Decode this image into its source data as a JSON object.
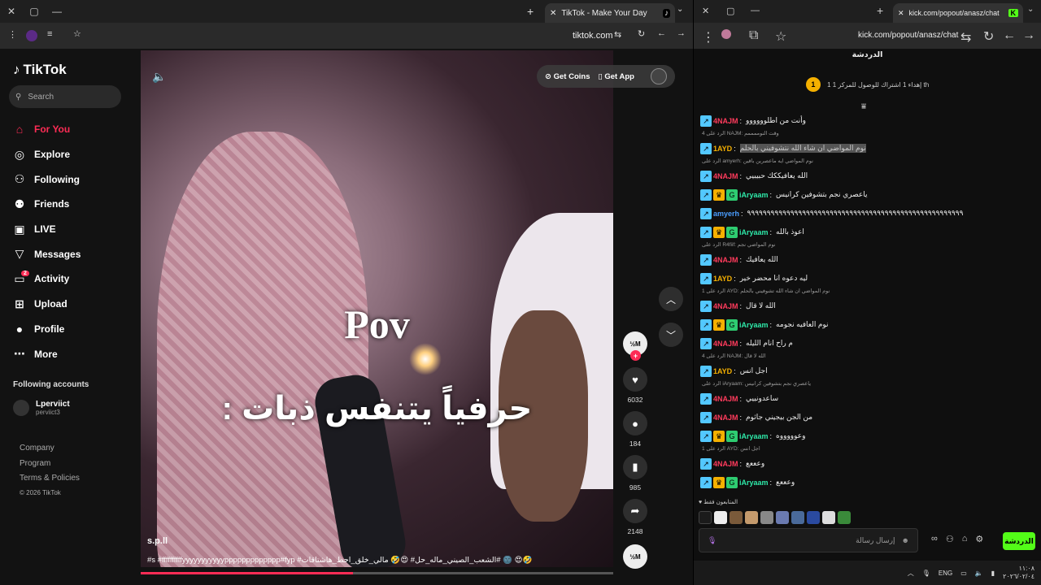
{
  "left_window": {
    "tab_title": "TikTok - Make Your Day",
    "address": "tiktok.com"
  },
  "tiktok": {
    "logo_text": "TikTok",
    "search_placeholder": "Search",
    "nav": [
      {
        "label": "For You",
        "icon": "home-icon",
        "active": true
      },
      {
        "label": "Explore",
        "icon": "compass-icon"
      },
      {
        "label": "Following",
        "icon": "following-icon"
      },
      {
        "label": "Friends",
        "icon": "friends-icon"
      },
      {
        "label": "LIVE",
        "icon": "live-icon"
      },
      {
        "label": "Messages",
        "icon": "messages-icon"
      },
      {
        "label": "Activity",
        "icon": "activity-icon",
        "badge": "2"
      },
      {
        "label": "Upload",
        "icon": "upload-icon"
      },
      {
        "label": "Profile",
        "icon": "profile-icon"
      },
      {
        "label": "More",
        "icon": "more-icon"
      }
    ],
    "following_accounts_title": "Following accounts",
    "following_account": {
      "name": "Lperviict",
      "handle": "perviict3"
    },
    "footer": {
      "company": "Company",
      "program": "Program",
      "terms": "Terms & Policies",
      "copyright": "© 2026 TikTok"
    },
    "top_actions": {
      "get_coins": "Get Coins",
      "get_app": "Get App"
    },
    "video": {
      "overlay_title": "Pov",
      "overlay_caption": "حرفياً يتنفس ذبات :",
      "author": "s.p.ll",
      "description": "#s #ffffffffffyyyyyyyyyyyppppppppppppp#fyp #الشعب_الصيني_ماله_حل# 😍🤣 مالي_خلق_احط_هاشتاقات# 🌚 😍🤣",
      "progress": 0.45
    },
    "actions": {
      "avatar_label": "½M",
      "likes": "6032",
      "comments": "184",
      "saves": "985",
      "shares": "2148",
      "bottom_avatar_label": "½M"
    }
  },
  "right_window": {
    "tab_title": "kick.com/popout/anasz/chat",
    "address": "kick.com/popout/anasz/chat",
    "chat_title": "الدردشة",
    "pinned_text": "1 إهداء 1 اشتراك للوصول للمركز 1 th",
    "pinned_rank": "1",
    "messages": [
      {
        "reply": "",
        "user": "4NAJM",
        "color": "#ff3b5c",
        "badges": [
          "bot"
        ],
        "text": "وأنت من اطلوووووو",
        "highlight": false
      },
      {
        "reply": "الرد على 4 NAJM: وقت النوممممم",
        "user": "1AYD",
        "color": "#f5b000",
        "badges": [
          "bot"
        ],
        "text": "نوم المواضي ان شاء الله نتشوفيني بالحلم",
        "highlight": true
      },
      {
        "reply": "الرد على amyerh: نوم المواضي ايه ماعصرين باقين",
        "user": "4NAJM",
        "color": "#ff3b5c",
        "badges": [
          "bot"
        ],
        "text": "الله يعافيككك حبيبيي",
        "highlight": false
      },
      {
        "reply": "",
        "user": "iAryaam",
        "color": "#2ee8a8",
        "badges": [
          "bot",
          "crown",
          "gift"
        ],
        "text": "ياعصري نجم بتشوفين كرانيس",
        "highlight": false
      },
      {
        "reply": "",
        "user": "amyerh",
        "color": "#4a9eff",
        "badges": [
          "bot"
        ],
        "text": "٩٩٩٩٩٩٩٩٩٩٩٩٩٩٩٩٩٩٩٩٩٩٩٩٩٩٩٩٩٩٩٩٩٩٩٩٩٩٩٩٩٩٩٩٩٩٩٩٩٩٩٩٩٩٩",
        "highlight": false
      },
      {
        "reply": "",
        "user": "iAryaam",
        "color": "#2ee8a8",
        "badges": [
          "bot",
          "crown",
          "gift"
        ],
        "text": "اعوذ بالله",
        "highlight": false
      },
      {
        "reply": "الرد على R4fiif: نوم المواضي نجم",
        "user": "4NAJM",
        "color": "#ff3b5c",
        "badges": [
          "bot"
        ],
        "text": "الله يعافيك",
        "highlight": false
      },
      {
        "reply": "",
        "user": "1AYD",
        "color": "#f5b000",
        "badges": [
          "bot"
        ],
        "text": "ليه دعوه انا محضر خير",
        "highlight": false
      },
      {
        "reply": "الرد على 1 AYD: نوم المواضي ان شاء الله تشوفيني بالحلم",
        "user": "4NAJM",
        "color": "#ff3b5c",
        "badges": [
          "bot"
        ],
        "text": "الله لا قال",
        "highlight": false
      },
      {
        "reply": "",
        "user": "iAryaam",
        "color": "#2ee8a8",
        "badges": [
          "bot",
          "crown",
          "gift"
        ],
        "text": "نوم العافيه نجومه",
        "highlight": false
      },
      {
        "reply": "",
        "user": "4NAJM",
        "color": "#ff3b5c",
        "badges": [
          "bot"
        ],
        "text": "م راح انام الليله",
        "highlight": false
      },
      {
        "reply": "الرد على 4 NAJM: الله لا قال",
        "user": "1AYD",
        "color": "#f5b000",
        "badges": [
          "bot"
        ],
        "text": "اجل انس",
        "highlight": false
      },
      {
        "reply": "الرد على iAryaam: ياعصري نجم بتشوفين كرانيس",
        "user": "4NAJM",
        "color": "#ff3b5c",
        "badges": [
          "bot"
        ],
        "text": "ساعدونييي",
        "highlight": false
      },
      {
        "reply": "",
        "user": "4NAJM",
        "color": "#ff3b5c",
        "badges": [
          "bot"
        ],
        "text": "من الجن بيجيني جاثوم",
        "highlight": false
      },
      {
        "reply": "",
        "user": "iAryaam",
        "color": "#2ee8a8",
        "badges": [
          "bot",
          "crown",
          "gift"
        ],
        "text": "وعوووووه",
        "highlight": false
      },
      {
        "reply": "الرد على 1 AYD: اجل انس",
        "user": "4NAJM",
        "color": "#ff3b5c",
        "badges": [
          "bot"
        ],
        "text": "وعععع",
        "highlight": false
      },
      {
        "reply": "",
        "user": "iAryaam",
        "color": "#2ee8a8",
        "badges": [
          "bot",
          "crown",
          "gift"
        ],
        "text": "وعععع",
        "highlight": false
      }
    ],
    "viewers_label": "المتابعون فقط",
    "input_placeholder": "إرسال رسالة",
    "send_label": "الدردشة",
    "taskbar": {
      "lang": "ENG",
      "time": "١١:٠٨",
      "date": "٢٠٢٦/٠٢/٠٤"
    }
  }
}
